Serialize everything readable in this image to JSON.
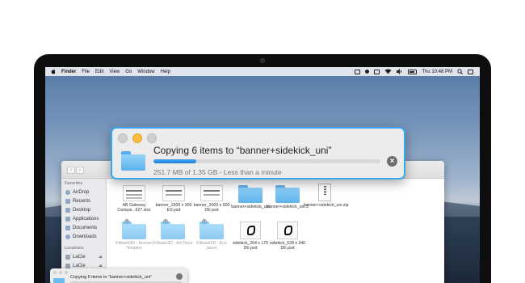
{
  "menubar": {
    "app": "Finder",
    "items": [
      "File",
      "Edit",
      "View",
      "Go",
      "Window",
      "Help"
    ],
    "clock": "Thu 10:48 PM"
  },
  "finder": {
    "sidebar": {
      "favorites_label": "Favorites",
      "favorites": [
        "AirDrop",
        "Recents",
        "Desktop",
        "Applications",
        "Documents",
        "Downloads"
      ],
      "locations_label": "Locations",
      "locations": [
        "LaCie",
        "LaCie"
      ]
    },
    "files": [
      {
        "name": "AB Gateway Campai...627.xlsx",
        "kind": "sheet"
      },
      {
        "name": "banner_1500 x 300 ES.psd",
        "kind": "sheet"
      },
      {
        "name": "banner_3000 x 600 DE.psd",
        "kind": "sheet"
      },
      {
        "name": "banner+sidekick_uni",
        "kind": "folder"
      },
      {
        "name": "banner+sidekick_uni.1",
        "kind": "folder"
      },
      {
        "name": "banner+sidekick_uni.zip",
        "kind": "zip"
      },
      {
        "name": "Kitbash3D - Ancient Temples",
        "kind": "folder-dim"
      },
      {
        "name": "Kitbash3D - Art Deco",
        "kind": "folder-dim"
      },
      {
        "name": "Kitbash3D - Eco Jason",
        "kind": "folder-dim"
      },
      {
        "name": "sidekick_264 x 170 DE.psd",
        "kind": "bw"
      },
      {
        "name": "sidekick_528 x 340 DE.psd",
        "kind": "bw"
      }
    ]
  },
  "copy_dialog": {
    "title": "Copying 6 items to “banner+sidekick_uni”",
    "status": "251.7 MB of 1.35 GB - Less than a minute",
    "progress": 0.19
  },
  "copy_dialog_small": {
    "title": "Copying 6 items to “banner+sidekick_uni”"
  }
}
